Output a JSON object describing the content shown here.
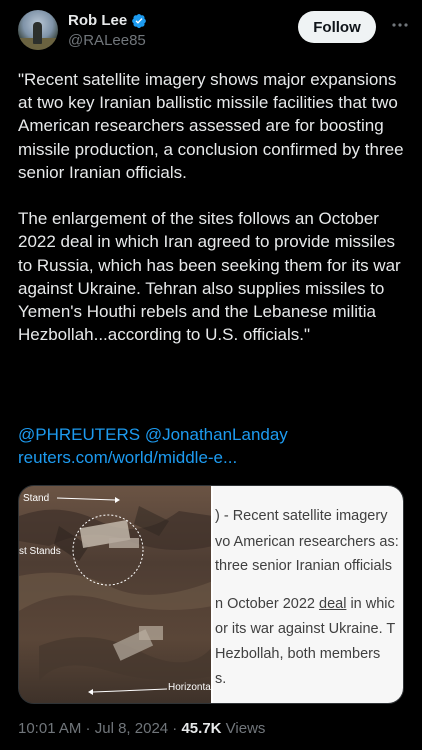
{
  "author": {
    "name": "Rob Lee",
    "handle": "@RALee85",
    "verified_color": "#1d9bf0"
  },
  "follow_label": "Follow",
  "more_icon": "ellipsis-icon",
  "tweet": {
    "text": "\"Recent satellite imagery shows major expansions at two key Iranian ballistic missile facilities that two American researchers assessed are for boosting missile production, a conclusion confirmed by three senior Iranian officials.\n\nThe enlargement of the sites follows an October 2022 deal in which Iran agreed to provide missiles to Russia, which has been seeking them for its war against Ukraine. Tehran also supplies missiles to Yemen's Houthi rebels and the Lebanese militia Hezbollah...according to U.S. officials.\"",
    "mentions": "@PHREUTERS @JonathanLanday",
    "link": "reuters.com/world/middle-e..."
  },
  "media": {
    "satellite_labels": {
      "stand": "Stand",
      "stands": "st Stands",
      "horizontal": "Horizonta"
    },
    "article_lines": [
      ") - Recent satellite imagery",
      "vo American researchers as:",
      "three senior Iranian officials",
      "n October 2022 ",
      "or its war against Ukraine. T",
      " Hezbollah, both members",
      "s."
    ],
    "article_underlined": "deal",
    "article_line4_tail": " in whic"
  },
  "footer": {
    "time": "10:01 AM",
    "sep1": " · ",
    "date": "Jul 8, 2024",
    "sep2": " · ",
    "views_count": "45.7K",
    "views_label": " Views"
  },
  "colors": {
    "background": "#000000",
    "text": "#e7e9ea",
    "secondary": "#71767b",
    "link": "#1d9bf0",
    "follow_bg": "#eff3f4"
  }
}
